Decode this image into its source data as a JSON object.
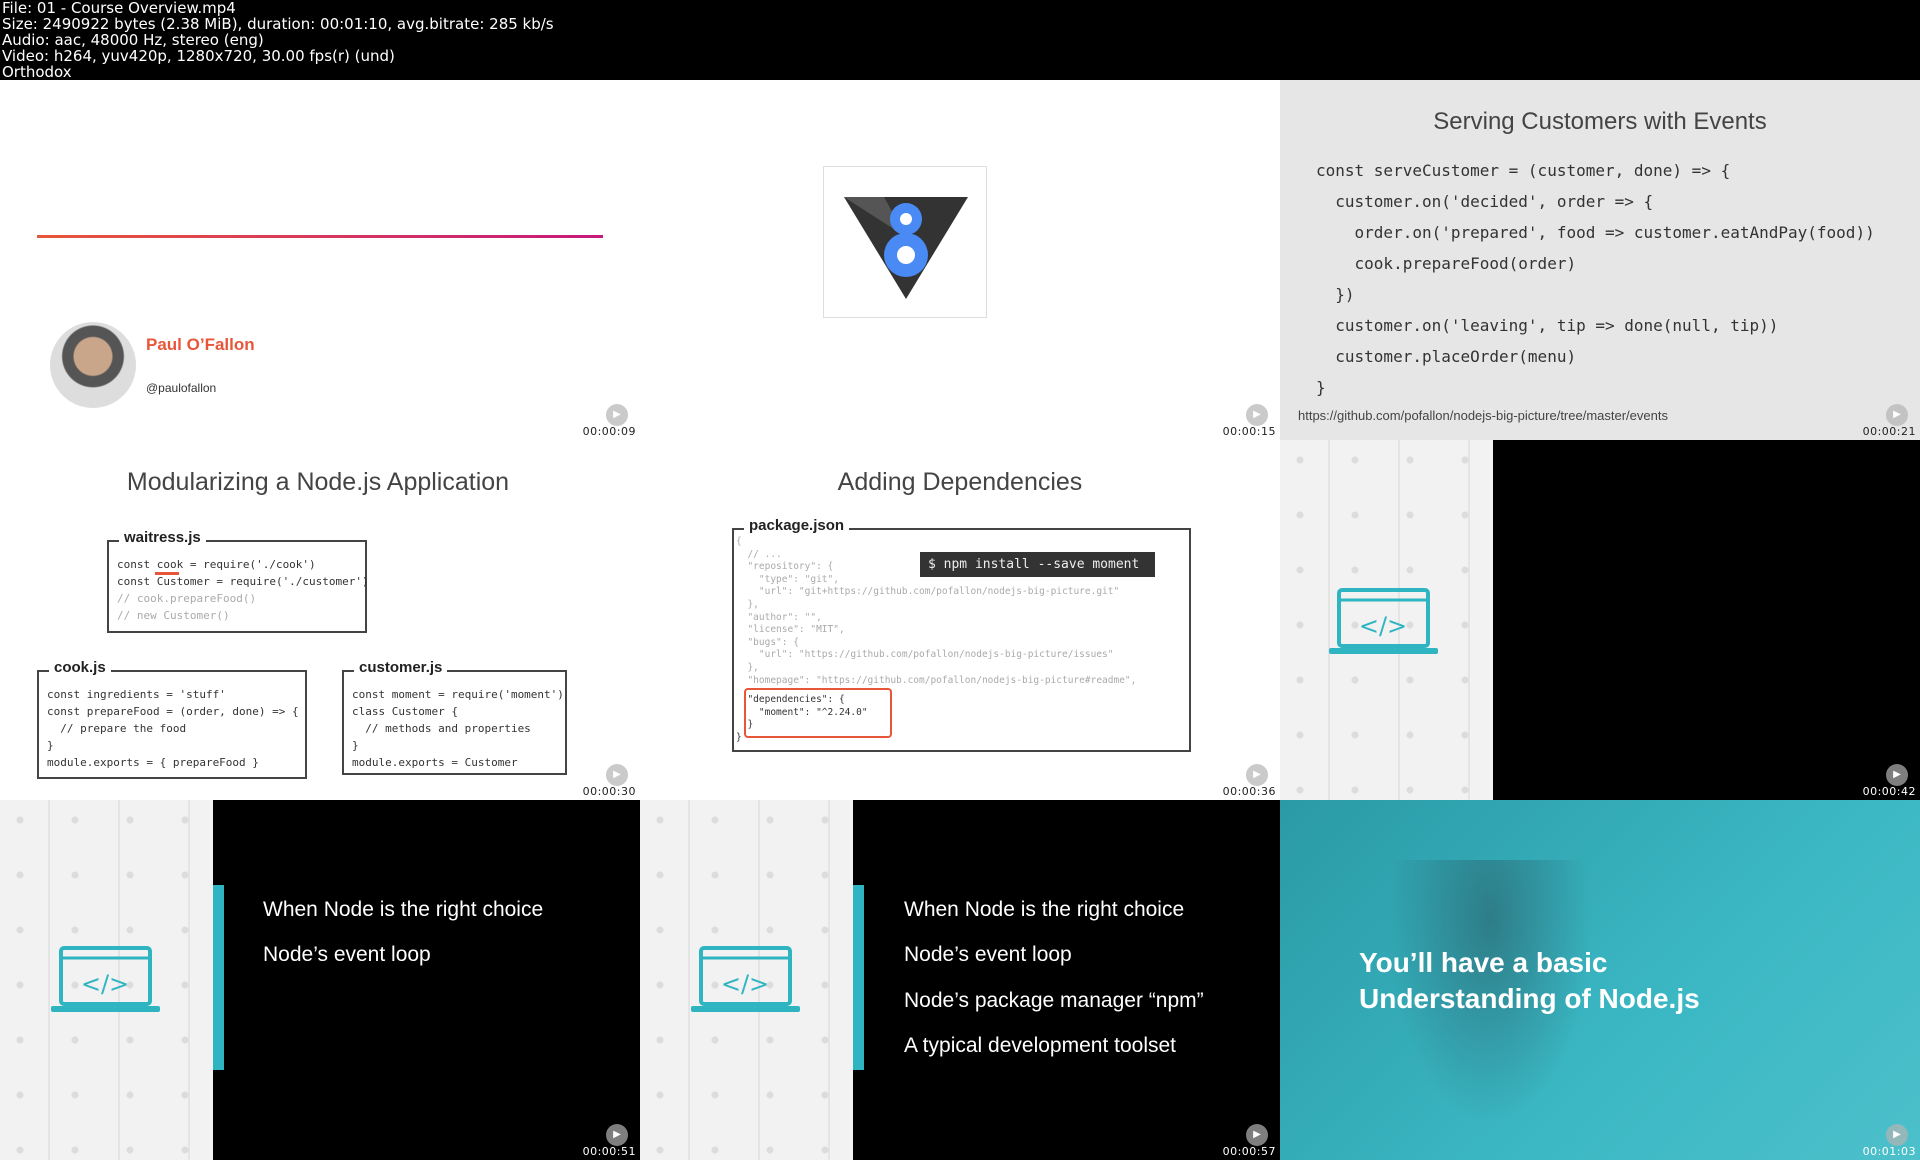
{
  "header": {
    "lines": [
      "File: 01 - Course Overview.mp4",
      "Size: 2490922 bytes (2.38 MiB), duration: 00:01:10, avg.bitrate: 285 kb/s",
      "Audio: aac, 48000 Hz, stereo (eng)",
      "Video: h264, yuv420p, 1280x720, 30.00 fps(r) (und)",
      "Orthodox"
    ]
  },
  "colors": {
    "accent_orange": "#e8563a",
    "accent_magenta": "#c5197d",
    "teal": "#2fb4c2",
    "slide_gray": "#e6e6e6"
  },
  "tiles": [
    {
      "timestamp": "00:00:09",
      "author_name": "Paul O’Fallon",
      "author_handle": "@paulofallon"
    },
    {
      "timestamp": "00:00:15",
      "logo": "v8-logo"
    },
    {
      "timestamp": "00:00:21",
      "title": "Serving Customers with Events",
      "code": [
        "const serveCustomer = (customer, done) => {",
        "  customer.on('decided', order => {",
        "    order.on('prepared', food => customer.eatAndPay(food))",
        "    cook.prepareFood(order)",
        "  })",
        "  customer.on('leaving', tip => done(null, tip))",
        "  customer.placeOrder(menu)",
        "}"
      ],
      "link": "https://github.com/pofallon/nodejs-big-picture/tree/master/events"
    },
    {
      "timestamp": "00:00:30",
      "title": "Modularizing a Node.js Application",
      "files": [
        {
          "name": "waitress.js",
          "code": "const cook = require('./cook')\nconst Customer = require('./customer')",
          "comment": "// cook.prepareFood()\n// new Customer()"
        },
        {
          "name": "cook.js",
          "code": "const ingredients = 'stuff'\nconst prepareFood = (order, done) => {\n  // prepare the food\n}\nmodule.exports = { prepareFood }"
        },
        {
          "name": "customer.js",
          "code": "const moment = require('moment')\nclass Customer {\n  // methods and properties\n}\nmodule.exports = Customer"
        }
      ]
    },
    {
      "timestamp": "00:00:36",
      "title": "Adding Dependencies",
      "file": "package.json",
      "code_faded": "{\n  // ...\n  \"repository\": {\n    \"type\": \"git\",\n    \"url\": \"git+https://github.com/pofallon/nodejs-big-picture.git\"\n  },\n  \"author\": \"\",\n  \"license\": \"MIT\",\n  \"bugs\": {\n    \"url\": \"https://github.com/pofallon/nodejs-big-picture/issues\"\n  },\n  \"homepage\": \"https://github.com/pofallon/nodejs-big-picture#readme\",",
      "code_highlight": "  \"dependencies\": {\n    \"moment\": \"^2.24.0\"\n  }\n}",
      "command": "$ npm install --save moment"
    },
    {
      "timestamp": "00:00:42"
    },
    {
      "timestamp": "00:00:51",
      "bullets": [
        "When Node is the right choice",
        "Node’s event loop"
      ]
    },
    {
      "timestamp": "00:00:57",
      "bullets": [
        "When Node is the right choice",
        "Node’s event loop",
        "Node’s package manager “npm”",
        "A typical development toolset"
      ]
    },
    {
      "timestamp": "00:01:03",
      "text": [
        "You’ll have a basic",
        "Understanding of Node.js"
      ]
    }
  ]
}
